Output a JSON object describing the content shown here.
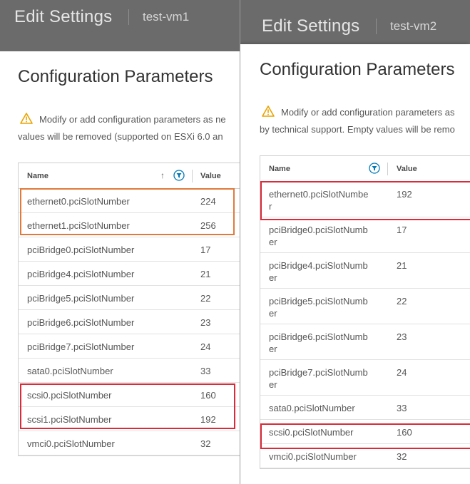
{
  "colors": {
    "highlight_orange": "#e07a3a",
    "highlight_red": "#d92b3a",
    "filter_icon": "#0079b8",
    "warning_icon": "#e8a300"
  },
  "left": {
    "header": {
      "title": "Edit Settings",
      "vm": "test-vm1"
    },
    "panel": {
      "title": "Configuration Parameters",
      "warning_line1": "Modify or add configuration parameters as ne",
      "warning_line2": "values will be removed (supported on ESXi 6.0 an"
    },
    "grid": {
      "col_name": "Name",
      "col_value": "Value",
      "rows": [
        {
          "name": "ethernet0.pciSlotNumber",
          "value": "224"
        },
        {
          "name": "ethernet1.pciSlotNumber",
          "value": "256"
        },
        {
          "name": "pciBridge0.pciSlotNumber",
          "value": "17"
        },
        {
          "name": "pciBridge4.pciSlotNumber",
          "value": "21"
        },
        {
          "name": "pciBridge5.pciSlotNumber",
          "value": "22"
        },
        {
          "name": "pciBridge6.pciSlotNumber",
          "value": "23"
        },
        {
          "name": "pciBridge7.pciSlotNumber",
          "value": "24"
        },
        {
          "name": "sata0.pciSlotNumber",
          "value": "33"
        },
        {
          "name": "scsi0.pciSlotNumber",
          "value": "160"
        },
        {
          "name": "scsi1.pciSlotNumber",
          "value": "192"
        },
        {
          "name": "vmci0.pciSlotNumber",
          "value": "32"
        }
      ]
    }
  },
  "right": {
    "header": {
      "title": "Edit Settings",
      "vm": "test-vm2"
    },
    "panel": {
      "title": "Configuration Parameters",
      "warning_line1": "Modify or add configuration parameters as",
      "warning_line2": "by technical support. Empty values will be remo"
    },
    "grid": {
      "col_name": "Name",
      "col_value": "Value",
      "rows": [
        {
          "name_line1": "ethernet0.pciSlotNumbe",
          "name_line2": "r",
          "value": "192"
        },
        {
          "name_line1": "pciBridge0.pciSlotNumb",
          "name_line2": "er",
          "value": "17"
        },
        {
          "name_line1": "pciBridge4.pciSlotNumb",
          "name_line2": "er",
          "value": "21"
        },
        {
          "name_line1": "pciBridge5.pciSlotNumb",
          "name_line2": "er",
          "value": "22"
        },
        {
          "name_line1": "pciBridge6.pciSlotNumb",
          "name_line2": "er",
          "value": "23"
        },
        {
          "name_line1": "pciBridge7.pciSlotNumb",
          "name_line2": "er",
          "value": "24"
        },
        {
          "name_line1": "sata0.pciSlotNumber",
          "name_line2": "",
          "value": "33"
        },
        {
          "name_line1": "scsi0.pciSlotNumber",
          "name_line2": "",
          "value": "160"
        },
        {
          "name_line1": "vmci0.pciSlotNumber",
          "name_line2": "",
          "value": "32"
        }
      ]
    }
  }
}
